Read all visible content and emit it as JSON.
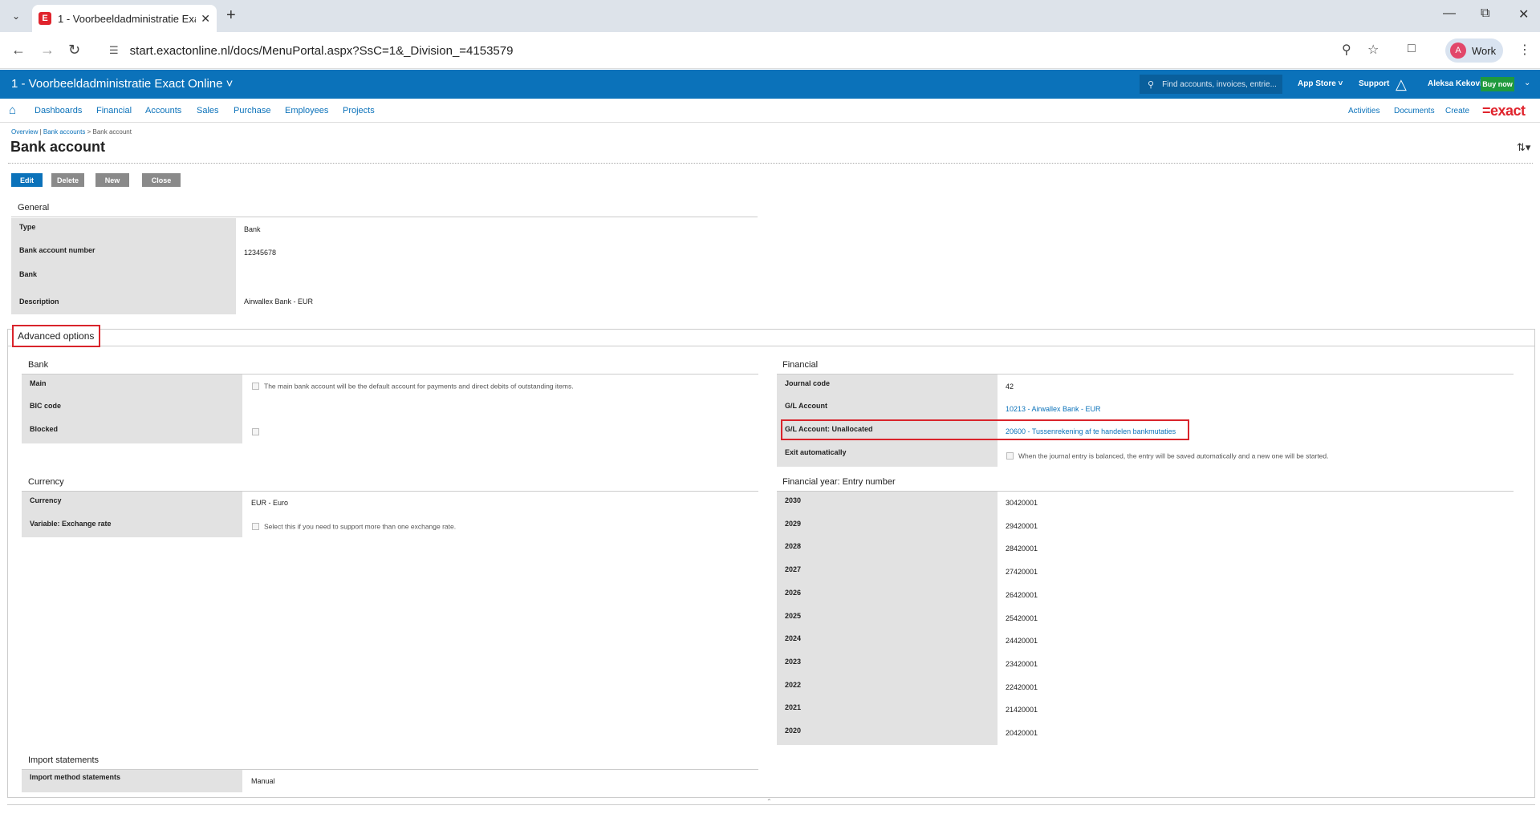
{
  "browser": {
    "tab_title": "1 - Voorbeeldadministratie Exa",
    "tab_favicon": "E",
    "url": "start.exactonline.nl/docs/MenuPortal.aspx?SsC=1&_Division_=4153579",
    "profile_initial": "A",
    "profile_label": "Work"
  },
  "header": {
    "title": "1 - Voorbeeldadministratie Exact Online ˅",
    "search_placeholder": "Find accounts, invoices, entrie...",
    "app_store": "App Store ˅",
    "support": "Support",
    "user": "Aleksa Kekovic",
    "buy_now": "Buy now",
    "brand_color": "#0b72ba"
  },
  "menu": {
    "items": [
      "Dashboards",
      "Financial",
      "Accounts",
      "Sales",
      "Purchase",
      "Employees",
      "Projects"
    ],
    "right": [
      "Activities",
      "Documents",
      "Create"
    ],
    "logo": "=exact"
  },
  "breadcrumb": {
    "overview": "Overview",
    "sep1": " | ",
    "bank_accounts": "Bank accounts",
    "sep2": " > ",
    "current": "Bank account"
  },
  "page": {
    "title": "Bank account"
  },
  "buttons": {
    "edit": "Edit",
    "delete": "Delete",
    "new": "New",
    "close": "Close"
  },
  "general": {
    "label": "General",
    "rows": [
      {
        "label": "Type",
        "value": "Bank"
      },
      {
        "label": "Bank account number",
        "value": "12345678"
      },
      {
        "label": "Bank",
        "value": ""
      },
      {
        "label": "Description",
        "value": "Airwallex Bank - EUR"
      }
    ]
  },
  "advanced": {
    "tab_label": "Advanced options",
    "bank": {
      "label": "Bank",
      "main_label": "Main",
      "main_note": "The main bank account will be the default account for payments and direct debits of outstanding items.",
      "bic_label": "BIC code",
      "blocked_label": "Blocked"
    },
    "currency": {
      "label": "Currency",
      "currency_label": "Currency",
      "currency_value": "EUR - Euro",
      "variable_label": "Variable: Exchange rate",
      "variable_note": "Select this if you need to support more than one exchange rate."
    },
    "import": {
      "label": "Import statements",
      "method_label": "Import method statements",
      "method_value": "Manual"
    },
    "financial": {
      "label": "Financial",
      "journal_label": "Journal code",
      "journal_value": "42",
      "gl_label": "G/L Account",
      "gl_value": "10213 - Airwallex Bank - EUR",
      "gl_unalloc_label": "G/L Account: Unallocated",
      "gl_unalloc_value": "20600 - Tussenrekening af te handelen bankmutaties",
      "exit_label": "Exit automatically",
      "exit_note": "When the journal entry is balanced, the entry will be saved automatically and a new one will be started."
    },
    "entry_numbers": {
      "label": "Financial year: Entry number",
      "rows": [
        {
          "year": "2030",
          "number": "30420001"
        },
        {
          "year": "2029",
          "number": "29420001"
        },
        {
          "year": "2028",
          "number": "28420001"
        },
        {
          "year": "2027",
          "number": "27420001"
        },
        {
          "year": "2026",
          "number": "26420001"
        },
        {
          "year": "2025",
          "number": "25420001"
        },
        {
          "year": "2024",
          "number": "24420001"
        },
        {
          "year": "2023",
          "number": "23420001"
        },
        {
          "year": "2022",
          "number": "22420001"
        },
        {
          "year": "2021",
          "number": "21420001"
        },
        {
          "year": "2020",
          "number": "20420001"
        }
      ]
    }
  }
}
